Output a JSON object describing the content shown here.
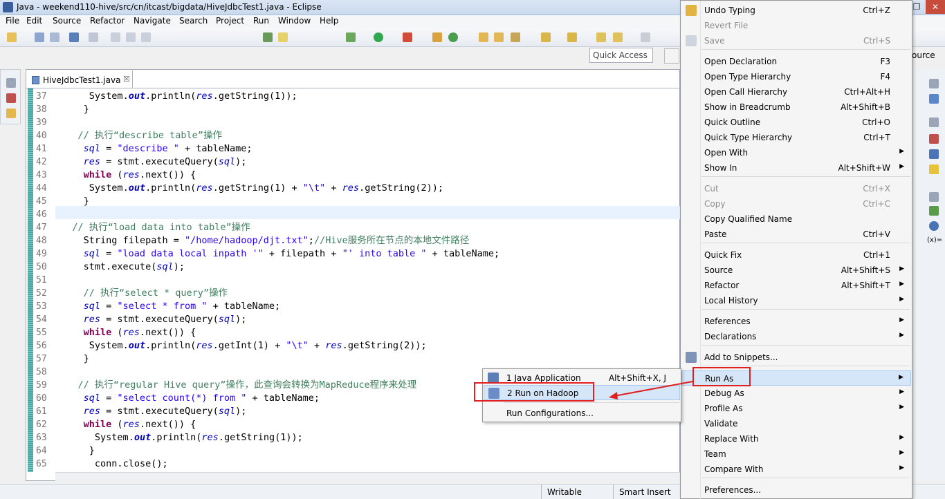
{
  "window": {
    "title": "Java - weekend110-hive/src/cn/itcast/bigdata/HiveJdbcTest1.java - Eclipse"
  },
  "menubar": [
    "File",
    "Edit",
    "Source",
    "Refactor",
    "Navigate",
    "Search",
    "Project",
    "Run",
    "Window",
    "Help"
  ],
  "toolbar": {
    "quick_access": "Quick Access"
  },
  "editor": {
    "tab_label": "HiveJdbcTest1.java",
    "tab_close": "☒",
    "lines": [
      {
        "n": "37",
        "t": "      System.out.println(res.getString(1));"
      },
      {
        "n": "38",
        "t": "     }"
      },
      {
        "n": "39",
        "t": ""
      },
      {
        "n": "40",
        "t": "    // 执行“describe table”操作"
      },
      {
        "n": "41",
        "t": "     sql = \"describe \" + tableName;"
      },
      {
        "n": "42",
        "t": "     res = stmt.executeQuery(sql);"
      },
      {
        "n": "43",
        "t": "     while (res.next()) {"
      },
      {
        "n": "44",
        "t": "      System.out.println(res.getString(1) + \"\\t\" + res.getString(2));"
      },
      {
        "n": "45",
        "t": "     }"
      },
      {
        "n": "46",
        "t": ""
      },
      {
        "n": "47",
        "t": "   // 执行“load data into table”操作"
      },
      {
        "n": "48",
        "t": "     String filepath = \"/home/hadoop/djt.txt\";//Hive服务所在节点的本地文件路径"
      },
      {
        "n": "49",
        "t": "     sql = \"load data local inpath '\" + filepath + \"' into table \" + tableName;"
      },
      {
        "n": "50",
        "t": "     stmt.execute(sql);"
      },
      {
        "n": "51",
        "t": ""
      },
      {
        "n": "52",
        "t": "     // 执行“select * query”操作"
      },
      {
        "n": "53",
        "t": "     sql = \"select * from \" + tableName;"
      },
      {
        "n": "54",
        "t": "     res = stmt.executeQuery(sql);"
      },
      {
        "n": "55",
        "t": "     while (res.next()) {"
      },
      {
        "n": "56",
        "t": "      System.out.println(res.getInt(1) + \"\\t\" + res.getString(2));"
      },
      {
        "n": "57",
        "t": "     }"
      },
      {
        "n": "58",
        "t": ""
      },
      {
        "n": "59",
        "t": "    // 执行“regular Hive query”操作，此查询会转换为MapReduce程序来处理"
      },
      {
        "n": "60",
        "t": "     sql = \"select count(*) from \" + tableName;"
      },
      {
        "n": "61",
        "t": "     res = stmt.executeQuery(sql);"
      },
      {
        "n": "62",
        "t": "     while (res.next()) {"
      },
      {
        "n": "63",
        "t": "       System.out.println(res.getString(1));"
      },
      {
        "n": "64",
        "t": "      }"
      },
      {
        "n": "65",
        "t": "       conn.close();"
      }
    ]
  },
  "right_panel": {
    "source_clip": "ource",
    "x_label": "(x)="
  },
  "status": {
    "writable": "Writable",
    "insert_mode": "Smart Insert"
  },
  "context_menu": {
    "items": [
      {
        "label": "Undo Typing",
        "shortcut": "Ctrl+Z"
      },
      {
        "label": "Revert File",
        "shortcut": ""
      },
      {
        "label": "Save",
        "shortcut": "Ctrl+S"
      },
      {
        "label": "Open Declaration",
        "shortcut": "F3"
      },
      {
        "label": "Open Type Hierarchy",
        "shortcut": "F4"
      },
      {
        "label": "Open Call Hierarchy",
        "shortcut": "Ctrl+Alt+H"
      },
      {
        "label": "Show in Breadcrumb",
        "shortcut": "Alt+Shift+B"
      },
      {
        "label": "Quick Outline",
        "shortcut": "Ctrl+O"
      },
      {
        "label": "Quick Type Hierarchy",
        "shortcut": "Ctrl+T"
      },
      {
        "label": "Open With",
        "shortcut": ""
      },
      {
        "label": "Show In",
        "shortcut": "Alt+Shift+W"
      },
      {
        "label": "Cut",
        "shortcut": "Ctrl+X"
      },
      {
        "label": "Copy",
        "shortcut": "Ctrl+C"
      },
      {
        "label": "Copy Qualified Name",
        "shortcut": ""
      },
      {
        "label": "Paste",
        "shortcut": "Ctrl+V"
      },
      {
        "label": "Quick Fix",
        "shortcut": "Ctrl+1"
      },
      {
        "label": "Source",
        "shortcut": "Alt+Shift+S"
      },
      {
        "label": "Refactor",
        "shortcut": "Alt+Shift+T"
      },
      {
        "label": "Local History",
        "shortcut": ""
      },
      {
        "label": "References",
        "shortcut": ""
      },
      {
        "label": "Declarations",
        "shortcut": ""
      },
      {
        "label": "Add to Snippets...",
        "shortcut": ""
      },
      {
        "label": "Run As",
        "shortcut": ""
      },
      {
        "label": "Debug As",
        "shortcut": ""
      },
      {
        "label": "Profile As",
        "shortcut": ""
      },
      {
        "label": "Validate",
        "shortcut": ""
      },
      {
        "label": "Replace With",
        "shortcut": ""
      },
      {
        "label": "Team",
        "shortcut": ""
      },
      {
        "label": "Compare With",
        "shortcut": ""
      },
      {
        "label": "Preferences...",
        "shortcut": ""
      }
    ]
  },
  "run_as_submenu": {
    "items": [
      {
        "label": "1 Java Application",
        "shortcut": "Alt+Shift+X, J"
      },
      {
        "label": "2 Run on Hadoop",
        "shortcut": ""
      },
      {
        "label": "Run Configurations...",
        "shortcut": ""
      }
    ]
  },
  "colors": {
    "accent": "#e02020",
    "keyword": "#7f0055",
    "string": "#2a00ff",
    "comment": "#3f7f5f",
    "field": "#0000c0"
  }
}
